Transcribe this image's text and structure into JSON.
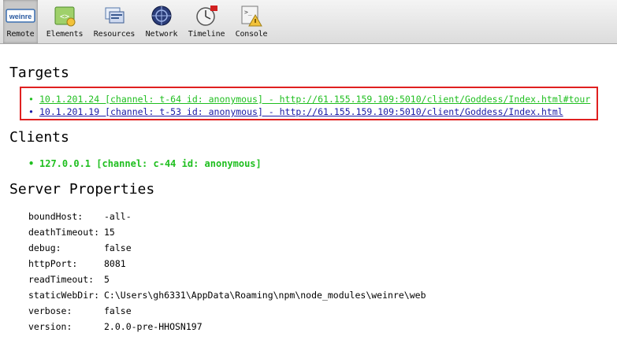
{
  "toolbar": {
    "items": [
      {
        "label": "Remote",
        "icon": "weinre-logo-icon"
      },
      {
        "label": "Elements",
        "icon": "elements-icon"
      },
      {
        "label": "Resources",
        "icon": "resources-icon"
      },
      {
        "label": "Network",
        "icon": "network-icon"
      },
      {
        "label": "Timeline",
        "icon": "timeline-icon"
      },
      {
        "label": "Console",
        "icon": "console-icon"
      }
    ],
    "logo_text": "weinre"
  },
  "targets": {
    "title": "Targets",
    "items": [
      {
        "text": "10.1.201.24 [channel: t-64 id: anonymous] - http://61.155.159.109:5010/client/Goddess/Index.html#tour",
        "color": "#1fbf1f"
      },
      {
        "text": "10.1.201.19 [channel: t-53 id: anonymous] - http://61.155.159.109:5010/client/Goddess/Index.html",
        "color": "#1a1aa6"
      }
    ]
  },
  "clients": {
    "title": "Clients",
    "items": [
      {
        "text": "127.0.0.1 [channel: c-44 id: anonymous]",
        "color": "#1fbf1f"
      }
    ]
  },
  "server_properties": {
    "title": "Server Properties",
    "rows": [
      {
        "key": "boundHost:",
        "value": "-all-"
      },
      {
        "key": "deathTimeout:",
        "value": "15"
      },
      {
        "key": "debug:",
        "value": "false"
      },
      {
        "key": "httpPort:",
        "value": "8081"
      },
      {
        "key": "readTimeout:",
        "value": "5"
      },
      {
        "key": "staticWebDir:",
        "value": "C:\\Users\\gh6331\\AppData\\Roaming\\npm\\node_modules\\weinre\\web"
      },
      {
        "key": "verbose:",
        "value": "false"
      },
      {
        "key": "version:",
        "value": "2.0.0-pre-HHOSN197"
      }
    ]
  },
  "colors": {
    "highlight_box": "#e02020",
    "active_target": "#1fbf1f",
    "inactive_target": "#1a1aa6"
  }
}
